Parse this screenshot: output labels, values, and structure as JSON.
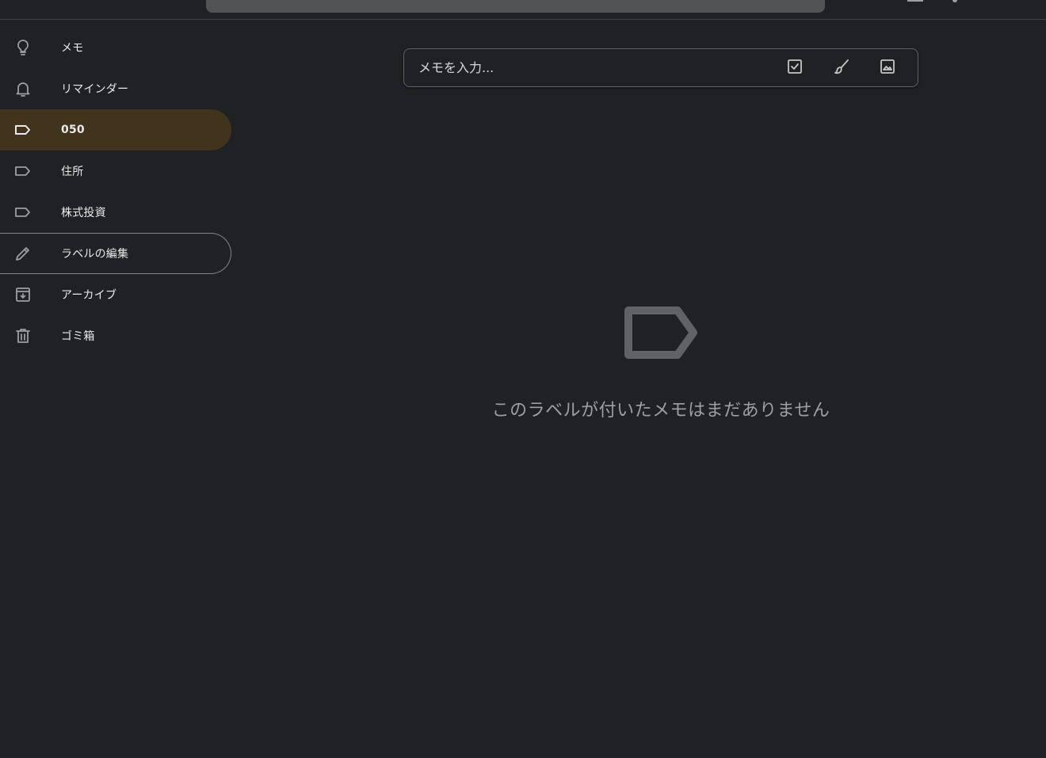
{
  "sidebar": {
    "items": [
      {
        "label": "メモ",
        "icon": "lightbulb-icon"
      },
      {
        "label": "リマインダー",
        "icon": "bell-icon"
      },
      {
        "label": "050",
        "icon": "label-icon",
        "active": true
      },
      {
        "label": "住所",
        "icon": "label-icon"
      },
      {
        "label": "株式投資",
        "icon": "label-icon"
      },
      {
        "label": "ラベルの編集",
        "icon": "pencil-icon",
        "outlined": true
      },
      {
        "label": "アーカイブ",
        "icon": "archive-icon"
      },
      {
        "label": "ゴミ箱",
        "icon": "trash-icon"
      }
    ]
  },
  "composer": {
    "placeholder": "メモを入力...",
    "actions": [
      "checkbox-icon",
      "brush-icon",
      "image-icon"
    ]
  },
  "empty_state": {
    "icon": "label-outline-icon",
    "message": "このラベルが付いたメモはまだありません"
  },
  "colors": {
    "background": "#202124",
    "active_item": "#41331c",
    "text": "#e8eaed",
    "muted_text": "#9aa0a6"
  }
}
